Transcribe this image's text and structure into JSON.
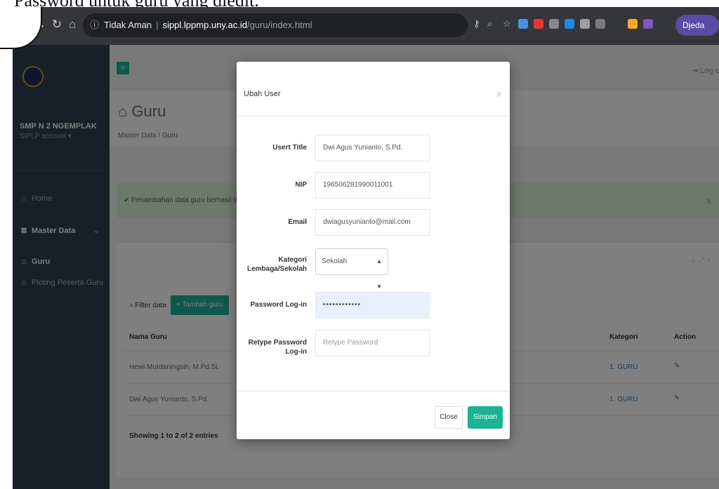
{
  "caption": "Password untuk guru yang diedit.",
  "browser": {
    "security": "Tidak Aman",
    "domain": "sippl.lppmp.uny.ac.id",
    "path": "/guru/index.html",
    "profile": "Djeda",
    "ext_colors": [
      "#4a90e2",
      "#e53935",
      "#888888",
      "#1e88e5",
      "#9e9e9e",
      "#7b7b7b",
      "#f9a825",
      "#7e57c2"
    ]
  },
  "sidebar": {
    "school": "SMP N 2 NGEMPLAK",
    "account": "SIPLP account",
    "items": [
      {
        "label": "Home",
        "icon": "home-icon"
      },
      {
        "label": "Master Data",
        "icon": "database-icon"
      },
      {
        "label": "Guru",
        "icon": "bank-icon"
      },
      {
        "label": "Ploting Peserta Guru",
        "icon": "users-icon"
      }
    ]
  },
  "header": {
    "logout": "Log out"
  },
  "page": {
    "title": "Guru",
    "breadcrumb": [
      "Master Data",
      "Guru"
    ]
  },
  "alert": {
    "text": "Penambahan data guru berhasil disimpan"
  },
  "table": {
    "filter_label": "Filter data",
    "add_label": "+ Tambah guru",
    "columns": [
      "Nama Guru",
      "Kategori",
      "Action"
    ],
    "rows": [
      {
        "name": "Hewi Murdaningsih, M.Pd.Si.",
        "kategori": "1. GURU"
      },
      {
        "name": "Dwi Agus Yunianto, S.Pd.",
        "kategori": "1. GURU"
      }
    ],
    "showing": "Showing 1 to 2 of 2 entries"
  },
  "modal": {
    "title": "Ubah User",
    "fields": {
      "user_title": {
        "label": "Usert Title",
        "value": "Dwi Agus Yunianto, S.Pd."
      },
      "nip": {
        "label": "NIP",
        "value": "196506281990011001"
      },
      "email": {
        "label": "Email",
        "value": "dwiagusyunianto@mail.com"
      },
      "kategori": {
        "label": "Kategori Lembaga/Sekolah",
        "value": "Sekolah"
      },
      "password": {
        "label": "Password Log-in",
        "value": "••••••••••••"
      },
      "retype": {
        "label": "Retype Password Log-in",
        "placeholder": "Retype Password"
      }
    },
    "close_label": "Close",
    "save_label": "Simpan"
  }
}
